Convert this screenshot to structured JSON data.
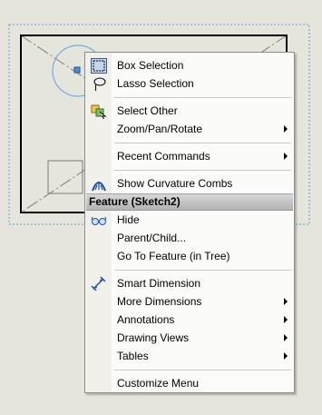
{
  "menu": {
    "box_selection": "Box Selection",
    "lasso_selection": "Lasso Selection",
    "select_other": "Select Other",
    "zoom_pan_rotate": "Zoom/Pan/Rotate",
    "recent_commands": "Recent Commands",
    "show_curvature_combs": "Show Curvature Combs",
    "section_header": "Feature (Sketch2)",
    "hide": "Hide",
    "parent_child": "Parent/Child...",
    "go_to_feature": "Go To Feature (in Tree)",
    "smart_dimension": "Smart Dimension",
    "more_dimensions": "More Dimensions",
    "annotations": "Annotations",
    "drawing_views": "Drawing Views",
    "tables": "Tables",
    "customize_menu": "Customize Menu"
  },
  "colors": {
    "canvas_bg": "#e6e5dc",
    "selection_dash": "#5aa0e6",
    "sketch_line": "#000000",
    "header_gradient_top": "#d7d7d7",
    "header_gradient_bottom": "#b3b3b3"
  },
  "icons": {
    "box_selection": "box-selection-icon",
    "lasso_selection": "lasso-icon",
    "select_other": "select-other-icon",
    "show_curvature_combs": "curvature-combs-icon",
    "hide": "glasses-hide-icon",
    "smart_dimension": "smart-dimension-icon"
  }
}
